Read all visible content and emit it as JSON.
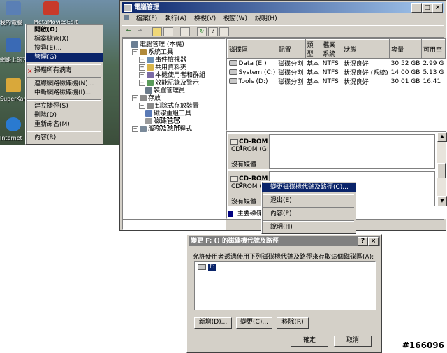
{
  "desktop": {
    "icons": [
      {
        "label": "我的電腦",
        "name": "my-computer-icon"
      },
      {
        "label": "MetaMoviesEdit",
        "name": "movie-app-icon"
      },
      {
        "label": "網路上的芳鄰",
        "name": "network-places-icon"
      },
      {
        "label": "SuperKartLUX",
        "name": "super-app-icon"
      },
      {
        "label": "Internet",
        "name": "internet-icon"
      }
    ]
  },
  "context_menu": {
    "items": [
      {
        "label": "開啟(O)",
        "bold": true
      },
      {
        "label": "檔案總管(X)"
      },
      {
        "label": "搜尋(E)..."
      },
      {
        "label": "管理(G)",
        "selected": true
      },
      {
        "sep": true
      },
      {
        "label": "掃瞄所有病毒",
        "icon": true
      },
      {
        "sep": true
      },
      {
        "label": "連線網路磁碟機(N)..."
      },
      {
        "label": "中斷網路磁碟機(I)..."
      },
      {
        "sep": true
      },
      {
        "label": "建立捷徑(S)"
      },
      {
        "label": "刪除(D)"
      },
      {
        "label": "重新命名(M)"
      },
      {
        "sep": true
      },
      {
        "label": "內容(R)"
      }
    ]
  },
  "window": {
    "title": "電腦管理",
    "menus": [
      "檔案(F)",
      "執行(A)",
      "檢視(V)",
      "視窗(W)",
      "說明(H)"
    ],
    "tree": [
      {
        "label": "電腦管理 (本機)",
        "level": 0,
        "exp": "",
        "color": "#6c7f94"
      },
      {
        "label": "系統工具",
        "level": 1,
        "exp": "−",
        "color": "#b08a3c"
      },
      {
        "label": "事件檢視器",
        "level": 2,
        "exp": "+",
        "color": "#6a8fb5"
      },
      {
        "label": "共用資料夾",
        "level": 2,
        "exp": "+",
        "color": "#d9b54a"
      },
      {
        "label": "本機使用者和群組",
        "level": 2,
        "exp": "+",
        "color": "#7a6aa5"
      },
      {
        "label": "效能記錄及警示",
        "level": 2,
        "exp": "+",
        "color": "#5a9a5a"
      },
      {
        "label": "裝置管理員",
        "level": 2,
        "exp": "",
        "color": "#6a7a8a"
      },
      {
        "label": "存放",
        "level": 1,
        "exp": "−",
        "color": "#8a8a8a"
      },
      {
        "label": "卸除式存放裝置",
        "level": 2,
        "exp": "+",
        "color": "#8a8a8a"
      },
      {
        "label": "磁碟重組工具",
        "level": 2,
        "exp": "",
        "color": "#5a7ab5"
      },
      {
        "label": "磁碟管理",
        "level": 2,
        "exp": "",
        "color": "#9a9a9a"
      },
      {
        "label": "服務及應用程式",
        "level": 1,
        "exp": "+",
        "color": "#7a8a9a"
      }
    ],
    "columns": [
      "磁碟區",
      "配置",
      "類型",
      "檔案系統",
      "狀態",
      "容量",
      "可用空"
    ],
    "volumes": [
      [
        "Data (E:)",
        "磁碟分割",
        "基本",
        "NTFS",
        "狀況良好",
        "30.52 GB",
        "2.99 G"
      ],
      [
        "System (C:)",
        "磁碟分割",
        "基本",
        "NTFS",
        "狀況良好 (系統)",
        "14.00 GB",
        "5.13 G"
      ],
      [
        "Tools (D:)",
        "磁碟分割",
        "基本",
        "NTFS",
        "狀況良好",
        "30.01 GB",
        "16.41"
      ]
    ],
    "cdroms": [
      {
        "title": "CD-ROM 1",
        "sub": "CD-ROM (G:)",
        "state": "沒有媒體"
      },
      {
        "title": "CD-ROM 2",
        "sub": "CD-ROM (H",
        "state": "沒有媒體"
      }
    ],
    "legend": "主要磁碟",
    "popup": [
      "變更磁碟機代號及路徑(C)...",
      "退出(E)",
      "內容(P)",
      "說明(H)"
    ]
  },
  "dialog": {
    "title": "變更 F: () 的磁碟機代號及路徑",
    "help": "?",
    "close": "×",
    "desc": "允許使用者透過使用下列磁碟機代號及路徑來存取這個磁碟區(A):",
    "list_item": "F:",
    "add": "新增(D)...",
    "change": "變更(C)...",
    "remove": "移除(R)",
    "ok": "確定",
    "cancel": "取消"
  },
  "watermark": "#166096"
}
